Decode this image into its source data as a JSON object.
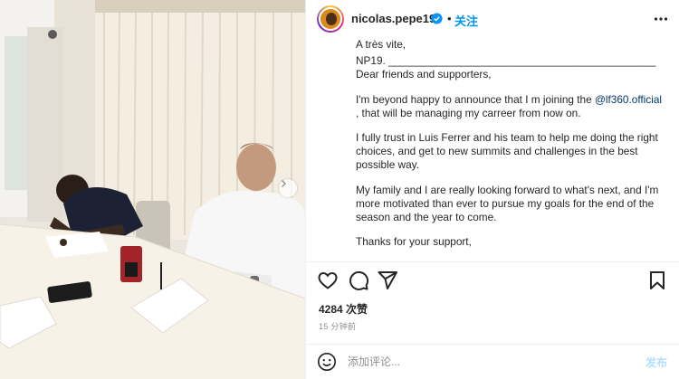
{
  "post": {
    "author": {
      "username": "nicolas.pepe19",
      "verified": true,
      "separator": "•",
      "follow_label": "关注"
    },
    "caption": {
      "paragraphs": [
        "A très vite,",
        "NP19. _____________________________________________ Dear friends and supporters,",
        "I'm beyond happy to announce that I m joining the",
        "I fully trust in Luis Ferrer and his team to help me doing the right choices, and get to new summits and challenges in the best possible way.",
        "My family and I are really looking forward to what's next, and I'm more motivated than ever to pursue my goals for the end of the season and the year to come.",
        "Thanks for your support,"
      ],
      "mention": "@lf360.official",
      "after_mention": " , that will be managing my carreer from now on."
    },
    "likes": "4284 次赞",
    "time": "15 分钟前",
    "comment": {
      "placeholder": "添加评论...",
      "post_label": "发布"
    },
    "icons": {
      "like": "heart-icon",
      "comment": "comment-icon",
      "share": "share-icon",
      "save": "bookmark-icon",
      "more": "more-icon",
      "emoji": "emoji-icon",
      "carousel": "chevron-right-icon"
    },
    "colors": {
      "accent": "#0095f6",
      "mention": "#00376b",
      "muted": "#8e8e8e",
      "text": "#262626"
    }
  }
}
